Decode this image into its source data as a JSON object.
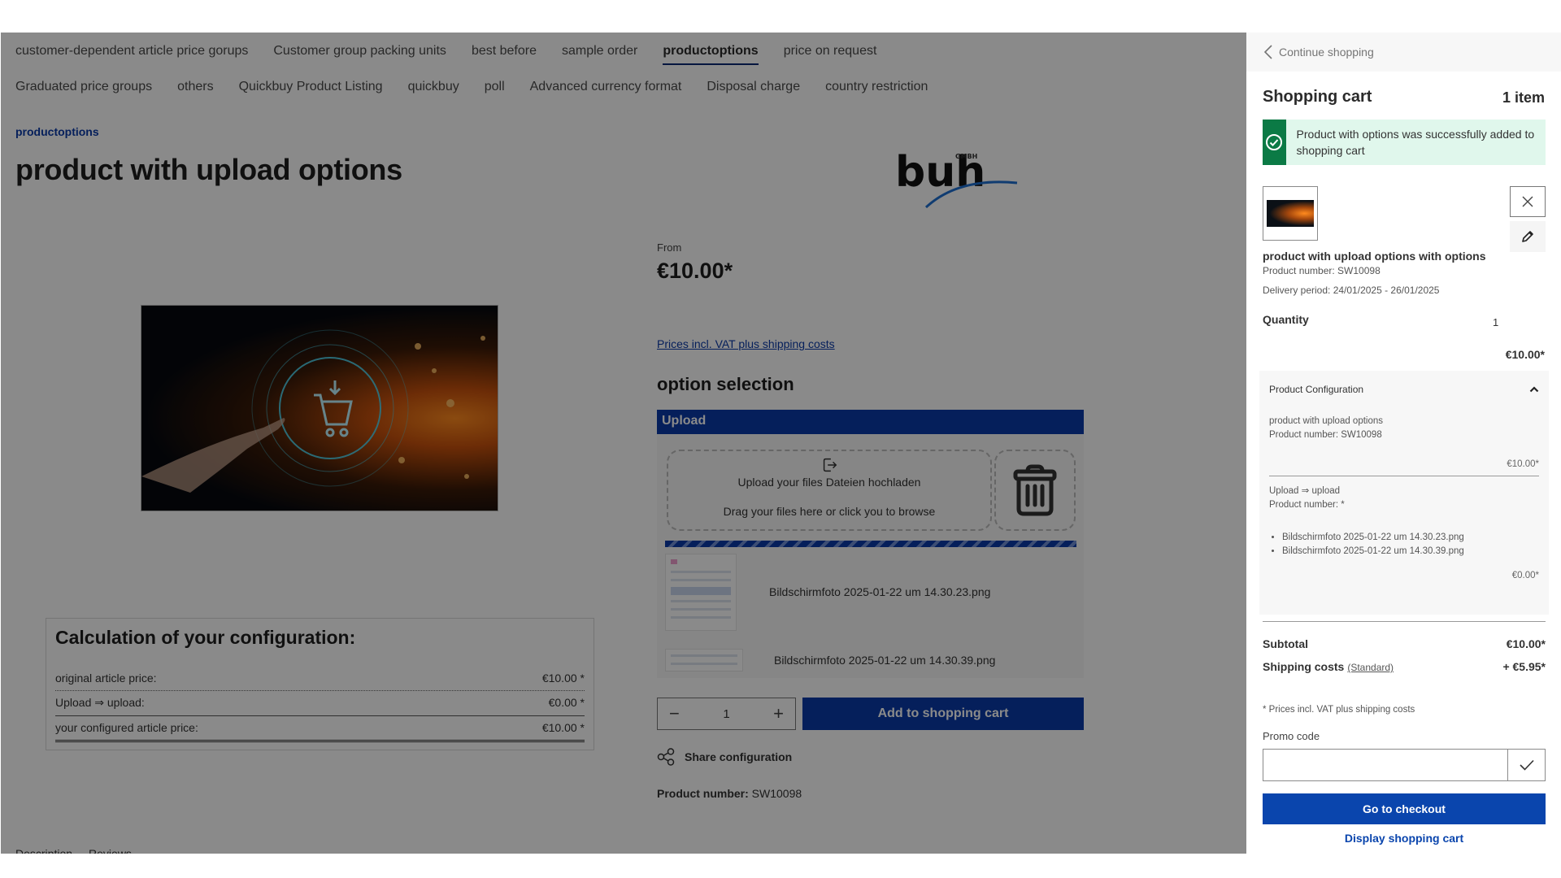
{
  "nav": {
    "row1": [
      {
        "label": "customer-dependent article price gorups",
        "active": false
      },
      {
        "label": "Customer group packing units",
        "active": false
      },
      {
        "label": "best before",
        "active": false
      },
      {
        "label": "sample order",
        "active": false
      },
      {
        "label": "productoptions",
        "active": true
      },
      {
        "label": "price on request",
        "active": false
      }
    ],
    "row2": [
      {
        "label": "Graduated price groups"
      },
      {
        "label": "others"
      },
      {
        "label": "Quickbuy Product Listing"
      },
      {
        "label": "quickbuy"
      },
      {
        "label": "poll"
      },
      {
        "label": "Advanced currency format"
      },
      {
        "label": "Disposal charge"
      },
      {
        "label": "country restriction"
      }
    ]
  },
  "product": {
    "breadcrumb": "productoptions",
    "title": "product with upload options",
    "logo_text": "buh",
    "logo_suffix": "GMBH",
    "price_prefix": "From",
    "price": "€10.00*",
    "vat_link": "Prices incl. VAT plus shipping costs",
    "option_title": "option selection",
    "upload_bar_label": "Upload",
    "dropzone_title": "Upload your files Dateien hochladen",
    "dropzone_hint": "Drag your files here or click you to browse",
    "uploaded_files": [
      "Bildschirmfoto 2025-01-22 um 14.30.23.png",
      "Bildschirmfoto 2025-01-22 um 14.30.39.png"
    ],
    "quantity": "1",
    "add_to_cart_label": "Add to shopping cart",
    "share_label": "Share configuration",
    "product_number_label": "Product number:",
    "product_number": "SW10098",
    "bottom_tabs": [
      "Description",
      "Reviews"
    ]
  },
  "calculation": {
    "title": "Calculation of your configuration:",
    "rows": [
      {
        "label": "original article price:",
        "value": "€10.00 *"
      },
      {
        "label": "Upload ⇒ upload:",
        "value": "€0.00 *"
      },
      {
        "label": "your configured article price:",
        "value": "€10.00 *"
      }
    ]
  },
  "cart": {
    "continue_label": "Continue shopping",
    "title": "Shopping cart",
    "count": "1 item",
    "alert": "Product with options was successfully added to shopping cart",
    "item": {
      "name": "product with upload options with options",
      "number": "Product number: SW10098",
      "delivery": "Delivery period: 24/01/2025 - 26/01/2025",
      "quantity_label": "Quantity",
      "quantity": "1",
      "price": "€10.00*"
    },
    "config": {
      "title": "Product Configuration",
      "base_name": "product with upload options",
      "base_number": "Product number: SW10098",
      "base_price": "€10.00*",
      "option_name": "Upload ⇒ upload",
      "option_number": "Product number: *",
      "option_files": [
        "Bildschirmfoto 2025-01-22 um 14.30.23.png",
        "Bildschirmfoto 2025-01-22 um 14.30.39.png"
      ],
      "option_price": "€0.00*"
    },
    "subtotal_label": "Subtotal",
    "subtotal": "€10.00*",
    "shipping_label": "Shipping costs",
    "shipping_method": "(Standard)",
    "shipping": "+ €5.95*",
    "vat_note": "* Prices incl. VAT plus shipping costs",
    "promo_label": "Promo code",
    "promo_value": "",
    "promo_placeholder": "",
    "checkout_label": "Go to checkout",
    "display_cart_label": "Display shopping cart"
  },
  "colors": {
    "primary": "#0a3aa8",
    "success": "#0b7a45",
    "success_bg": "#e0f7ec",
    "overlay": "#8a8a8a"
  }
}
